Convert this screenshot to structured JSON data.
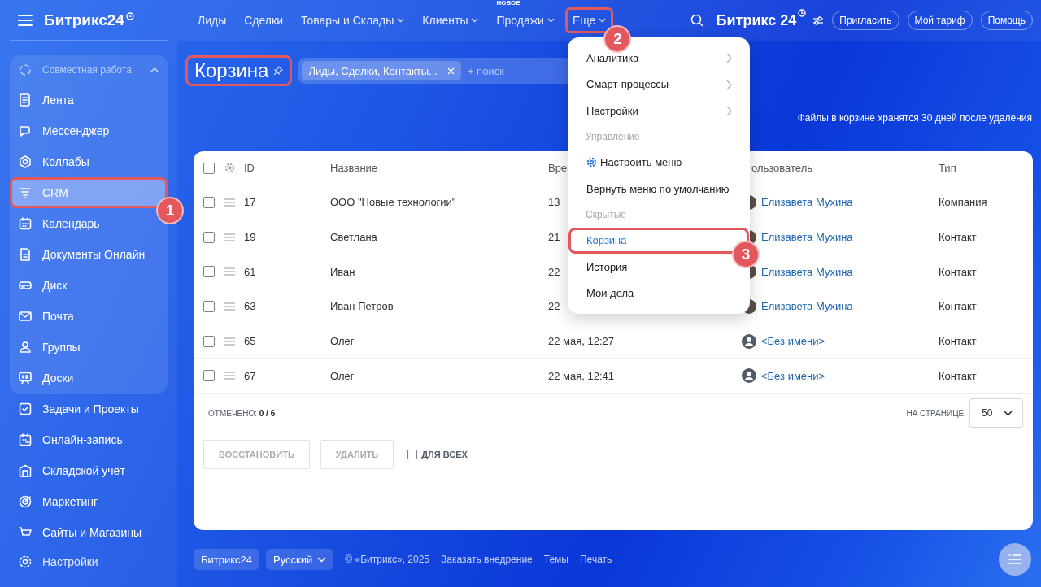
{
  "sidebar": {
    "logo": "Битрикс24",
    "group": {
      "title": "Совместная работа",
      "expanded": true,
      "items": [
        {
          "label": "Лента",
          "selected": false,
          "highlighted": false
        },
        {
          "label": "Мессенджер",
          "selected": false,
          "highlighted": false
        },
        {
          "label": "Коллабы",
          "selected": false,
          "highlighted": false
        },
        {
          "label": "CRM",
          "selected": true,
          "highlighted": true,
          "callout": "1"
        },
        {
          "label": "Календарь",
          "selected": false,
          "highlighted": false
        },
        {
          "label": "Документы Онлайн",
          "selected": false,
          "highlighted": false
        },
        {
          "label": "Диск",
          "selected": false,
          "highlighted": false
        },
        {
          "label": "Почта",
          "selected": false,
          "highlighted": false
        },
        {
          "label": "Группы",
          "selected": false,
          "highlighted": false
        },
        {
          "label": "Доски",
          "selected": false,
          "highlighted": false
        }
      ]
    },
    "items": [
      {
        "label": "Задачи и Проекты",
        "selected": false,
        "highlighted": false
      },
      {
        "label": "Онлайн-запись",
        "selected": false,
        "highlighted": false
      },
      {
        "label": "Складской учёт",
        "selected": false,
        "highlighted": false
      },
      {
        "label": "Маркетинг",
        "selected": false,
        "highlighted": false
      },
      {
        "label": "Сайты и Магазины",
        "selected": false,
        "highlighted": false
      }
    ],
    "settings": "Настройки"
  },
  "header": {
    "nav": [
      {
        "label": "Лиды",
        "dropdown": false,
        "highlighted": false
      },
      {
        "label": "Сделки",
        "dropdown": false,
        "highlighted": false
      },
      {
        "label": "Товары и Склады",
        "dropdown": true,
        "highlighted": false
      },
      {
        "label": "Клиенты",
        "dropdown": true,
        "highlighted": false
      },
      {
        "label": "Продажи",
        "dropdown": true,
        "highlighted": false,
        "badge": "НОВОЕ"
      },
      {
        "label": "Еще",
        "dropdown": true,
        "highlighted": true,
        "callout": "2"
      }
    ],
    "logo": "Битрикс 24",
    "buttons": [
      "Пригласить",
      "Мой тариф",
      "Помощь"
    ]
  },
  "page": {
    "title": "Корзина",
    "highlighted": true,
    "filter": {
      "chip": "Лиды, Сделки, Контакты...",
      "placeholder": "+ поиск"
    },
    "note": "Файлы в корзине хранятся 30 дней после удаления"
  },
  "table": {
    "all_checked": false,
    "columns": [
      "ID",
      "Название",
      "Вре",
      "ользователь",
      "Тип"
    ],
    "rows": [
      {
        "checked": false,
        "id": "17",
        "name": "ООО \"Новые технологии\"",
        "time": "13",
        "photo": true,
        "user": "Елизавета Мухина",
        "type": "Компания"
      },
      {
        "checked": false,
        "id": "19",
        "name": "Светлана",
        "time": "21",
        "photo": true,
        "user": "Елизавета Мухина",
        "type": "Контакт"
      },
      {
        "checked": false,
        "id": "61",
        "name": "Иван",
        "time": "22",
        "photo": true,
        "user": "Елизавета Мухина",
        "type": "Контакт"
      },
      {
        "checked": false,
        "id": "63",
        "name": "Иван Петров",
        "time": "22",
        "photo": true,
        "user": "Елизавета Мухина",
        "type": "Контакт"
      },
      {
        "checked": false,
        "id": "65",
        "name": "Олег",
        "time": "22 мая, 12:27",
        "photo": false,
        "user": "<Без имени>",
        "type": "Контакт"
      },
      {
        "checked": false,
        "id": "67",
        "name": "Олег",
        "time": "22 мая, 12:41",
        "photo": false,
        "user": "<Без имени>",
        "type": "Контакт"
      }
    ],
    "selected_label": "ОТМЕЧЕНО:",
    "selected_count": "0 / 6",
    "per_page_label": "НА СТРАНИЦЕ:",
    "per_page": "50"
  },
  "actions": {
    "buttons": [
      {
        "label": "ВОССТАНОВИТЬ",
        "disabled": true
      },
      {
        "label": "УДАЛИТЬ",
        "disabled": true
      }
    ],
    "for_all": {
      "label": "ДЛЯ ВСЕХ",
      "checked": false
    }
  },
  "menu": {
    "items": [
      {
        "kind": "submenu",
        "label": "Аналитика",
        "selected": false,
        "highlighted": false
      },
      {
        "kind": "submenu",
        "label": "Смарт-процессы",
        "selected": false,
        "highlighted": false
      },
      {
        "kind": "submenu",
        "label": "Настройки",
        "selected": false,
        "highlighted": false
      },
      {
        "kind": "section",
        "label": "Управление"
      },
      {
        "kind": "settings",
        "label": "Настроить меню",
        "selected": false,
        "highlighted": false
      },
      {
        "kind": "item",
        "label": "Вернуть меню по умолчанию",
        "selected": false,
        "highlighted": false
      },
      {
        "kind": "section",
        "label": "Скрытые"
      },
      {
        "kind": "item",
        "label": "Корзина",
        "selected": true,
        "highlighted": true,
        "callout": "3"
      },
      {
        "kind": "item",
        "label": "История",
        "selected": false,
        "highlighted": false
      },
      {
        "kind": "item",
        "label": "Мои дела",
        "selected": false,
        "highlighted": false
      }
    ]
  },
  "footer": {
    "brand": "Битрикс24",
    "language": "Русский",
    "copyright": "© «Битрикс», 2025",
    "links": [
      "Заказать внедрение",
      "Темы",
      "Печать"
    ]
  }
}
